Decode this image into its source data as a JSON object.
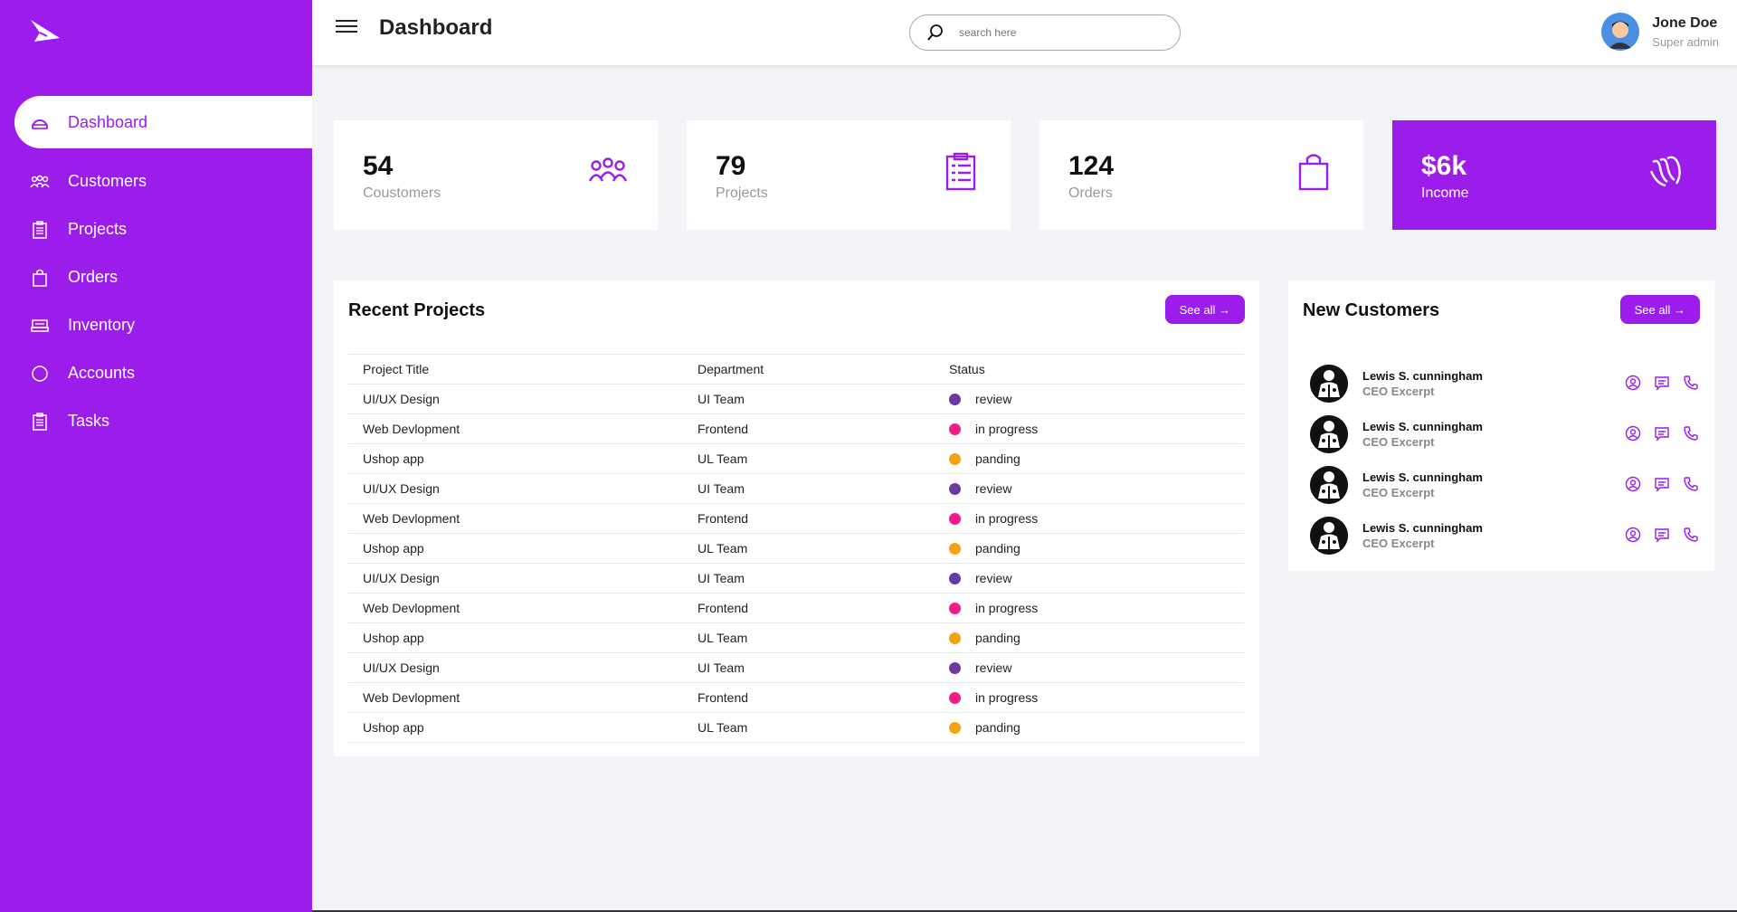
{
  "sidebar": {
    "items": [
      {
        "label": "Dashboard",
        "icon": "dashboard-icon"
      },
      {
        "label": "Customers",
        "icon": "people-icon"
      },
      {
        "label": "Projects",
        "icon": "clipboard-icon"
      },
      {
        "label": "Orders",
        "icon": "bag-icon"
      },
      {
        "label": "Inventory",
        "icon": "inventory-icon"
      },
      {
        "label": "Accounts",
        "icon": "circle-icon"
      },
      {
        "label": "Tasks",
        "icon": "clipboard-icon"
      }
    ]
  },
  "header": {
    "title": "Dashboard",
    "search_placeholder": "search here",
    "user_name": "Jone Doe",
    "user_role": "Super admin"
  },
  "cards": [
    {
      "value": "54",
      "label": "Coustomers",
      "icon": "people-icon"
    },
    {
      "value": "79",
      "label": "Projects",
      "icon": "clipboard-icon"
    },
    {
      "value": "124",
      "label": "Orders",
      "icon": "bag-icon"
    },
    {
      "value": "$6k",
      "label": "Income",
      "icon": "income-icon"
    }
  ],
  "projects": {
    "title": "Recent Projects",
    "see_all": "See all →",
    "columns": [
      "Project Title",
      "Department",
      "Status"
    ],
    "rows": [
      {
        "title": "UI/UX Design",
        "dept": "UI Team",
        "status": "review",
        "color": "#6a3aa2"
      },
      {
        "title": "Web Devlopment",
        "dept": "Frontend",
        "status": "in progress",
        "color": "#f31b8c"
      },
      {
        "title": "Ushop app",
        "dept": "UL Team",
        "status": "panding",
        "color": "#f4a30d"
      },
      {
        "title": "UI/UX Design",
        "dept": "UI Team",
        "status": "review",
        "color": "#6a3aa2"
      },
      {
        "title": "Web Devlopment",
        "dept": "Frontend",
        "status": "in progress",
        "color": "#f31b8c"
      },
      {
        "title": "Ushop app",
        "dept": "UL Team",
        "status": "panding",
        "color": "#f4a30d"
      },
      {
        "title": "UI/UX Design",
        "dept": "UI Team",
        "status": "review",
        "color": "#6a3aa2"
      },
      {
        "title": "Web Devlopment",
        "dept": "Frontend",
        "status": "in progress",
        "color": "#f31b8c"
      },
      {
        "title": "Ushop app",
        "dept": "UL Team",
        "status": "panding",
        "color": "#f4a30d"
      },
      {
        "title": "UI/UX Design",
        "dept": "UI Team",
        "status": "review",
        "color": "#6a3aa2"
      },
      {
        "title": "Web Devlopment",
        "dept": "Frontend",
        "status": "in progress",
        "color": "#f31b8c"
      },
      {
        "title": "Ushop app",
        "dept": "UL Team",
        "status": "panding",
        "color": "#f4a30d"
      }
    ]
  },
  "customers": {
    "title": "New Customers",
    "see_all": "See all →",
    "items": [
      {
        "name": "Lewis S. cunningham",
        "role": "CEO Excerpt"
      },
      {
        "name": "Lewis S. cunningham",
        "role": "CEO Excerpt"
      },
      {
        "name": "Lewis S. cunningham",
        "role": "CEO Excerpt"
      },
      {
        "name": "Lewis S. cunningham",
        "role": "CEO Excerpt"
      }
    ]
  },
  "colors": {
    "accent": "#9c1ceb",
    "review": "#6a3aa2",
    "progress": "#f31b8c",
    "pending": "#f4a30d"
  }
}
